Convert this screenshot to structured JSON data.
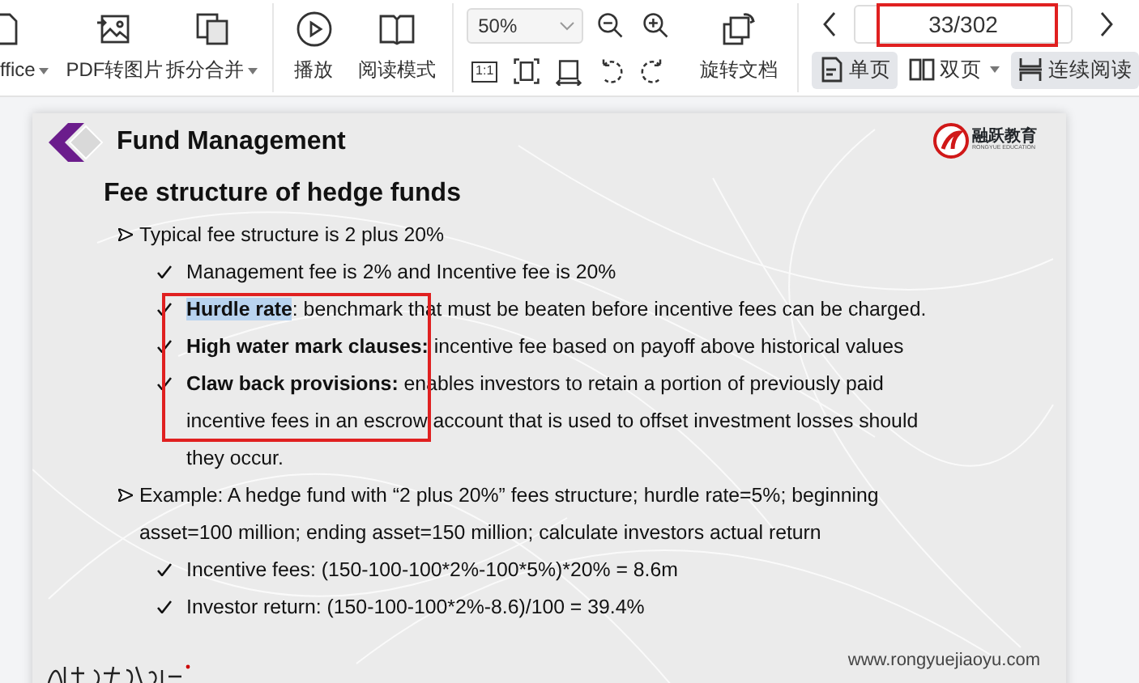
{
  "toolbar": {
    "tools": [
      {
        "kind": "doc",
        "label": "ffice",
        "dropdown": true
      },
      {
        "kind": "image",
        "label": "PDF转图片",
        "dropdown": false
      },
      {
        "kind": "split",
        "label": "拆分合并",
        "dropdown": true
      },
      {
        "kind": "play",
        "label": "播放",
        "dropdown": false
      },
      {
        "kind": "book",
        "label": "阅读模式",
        "dropdown": false
      }
    ],
    "zoom": {
      "value": "50%",
      "actual_size": "1:1"
    },
    "rotate_document": "旋转文档",
    "page_field": {
      "value": "33/302"
    },
    "view_modes": [
      {
        "kind": "single",
        "label": "单页",
        "selected": true,
        "dropdown": false
      },
      {
        "kind": "double",
        "label": "双页",
        "selected": false,
        "dropdown": true
      },
      {
        "kind": "continuous",
        "label": "连续阅读",
        "selected": true,
        "dropdown": false
      }
    ]
  },
  "slide": {
    "heading": "Fund Management",
    "logo": {
      "name": "融跃教育",
      "subtitle": "RONGYUE EDUCATION"
    },
    "title": "Fee structure of hedge funds",
    "bullets": [
      {
        "kind": "arrow",
        "text": "Typical fee structure is 2 plus 20%"
      },
      {
        "kind": "check",
        "text": "Management fee is 2% and Incentive fee is 20%"
      },
      {
        "kind": "check",
        "lead": "Hurdle rate",
        "lead_highlighted": true,
        "text": ": benchmark that must be beaten before incentive fees can be charged."
      },
      {
        "kind": "check",
        "lead": "High water mark clauses:",
        "lead_highlighted": false,
        "text": " incentive fee based on payoff above historical  values"
      },
      {
        "kind": "check",
        "lead": "Claw back provisions:",
        "lead_highlighted": false,
        "text": " enables investors to retain a portion of previously paid incentive fees in an escrow account that is used to offset investment losses should they occur."
      },
      {
        "kind": "arrow",
        "text": "Example: A hedge fund with “2 plus 20%” fees structure; hurdle rate=5%;  beginning asset=100 million; ending asset=150 million; calculate investors actual  return"
      },
      {
        "kind": "check",
        "text": "Incentive fees: (150-100-100*2%-100*5%)*20% = 8.6m"
      },
      {
        "kind": "check",
        "text": "Investor return: (150-100-100*2%-8.6)/100 = 39.4%"
      }
    ],
    "website": "www.rongyuejiaoyu.com"
  }
}
